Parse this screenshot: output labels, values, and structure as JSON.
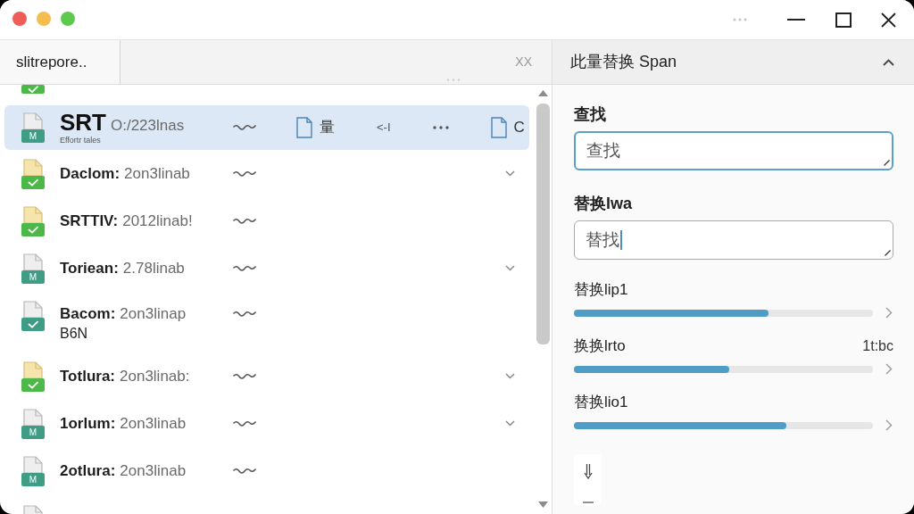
{
  "window": {
    "controls": [
      {
        "color": "#ee5e56"
      },
      {
        "color": "#f5bd4f"
      },
      {
        "color": "#5ec94f"
      }
    ]
  },
  "tabs": [
    {
      "label": "slitrepore..",
      "selected": true
    }
  ],
  "tab_bar_action": "XX",
  "file_list": {
    "top_partial_row": {
      "kind": "check"
    },
    "rows": [
      {
        "kind": "m",
        "selected": true,
        "name": "SRT",
        "detail": "O:/223lnas",
        "subtitle": "Effortr tales",
        "badge": "M",
        "expandable": false,
        "actions": [
          {
            "kind": "file",
            "label": "量"
          },
          {
            "kind": "text",
            "label": "<-I"
          },
          {
            "kind": "more"
          },
          {
            "kind": "file",
            "label": "C"
          }
        ]
      },
      {
        "kind": "check",
        "selected": false,
        "name": "Daclom:",
        "detail": "2on3linab",
        "expandable": true
      },
      {
        "kind": "check",
        "selected": false,
        "name": "SRTTIV:",
        "detail": "2012linab!",
        "expandable": false
      },
      {
        "kind": "m",
        "selected": false,
        "name": "Toriean:",
        "detail": "2.78linab",
        "badge": "M",
        "expandable": true
      },
      {
        "kind": "teal-check",
        "selected": false,
        "name": "Bacom:",
        "detail": "2on3linap",
        "second_line": "B6N",
        "expandable": false
      },
      {
        "kind": "check",
        "selected": false,
        "name": "Totlura:",
        "detail": "2on3linab:",
        "expandable": true
      },
      {
        "kind": "m",
        "selected": false,
        "name": "1orlum:",
        "detail": "2on3linab",
        "badge": "M",
        "expandable": true
      },
      {
        "kind": "m",
        "selected": false,
        "name": "2otlura:",
        "detail": "2on3linab",
        "badge": "M",
        "expandable": false
      }
    ],
    "bottom_partial_row": {
      "kind": "m"
    }
  },
  "panel": {
    "title": "此量替换 Span",
    "expanded": true,
    "find": {
      "label": "查找",
      "value": "查找",
      "focused": true
    },
    "replace": {
      "label": "替换lwa",
      "value": "替找",
      "focused": false,
      "cursor": true
    },
    "progress": [
      {
        "label": "替换lip1",
        "level": 0.65
      },
      {
        "label": "换换lrto",
        "reading": "1t:bc",
        "level": 0.52
      },
      {
        "label": "替换lio1",
        "level": 0.71
      }
    ]
  }
}
